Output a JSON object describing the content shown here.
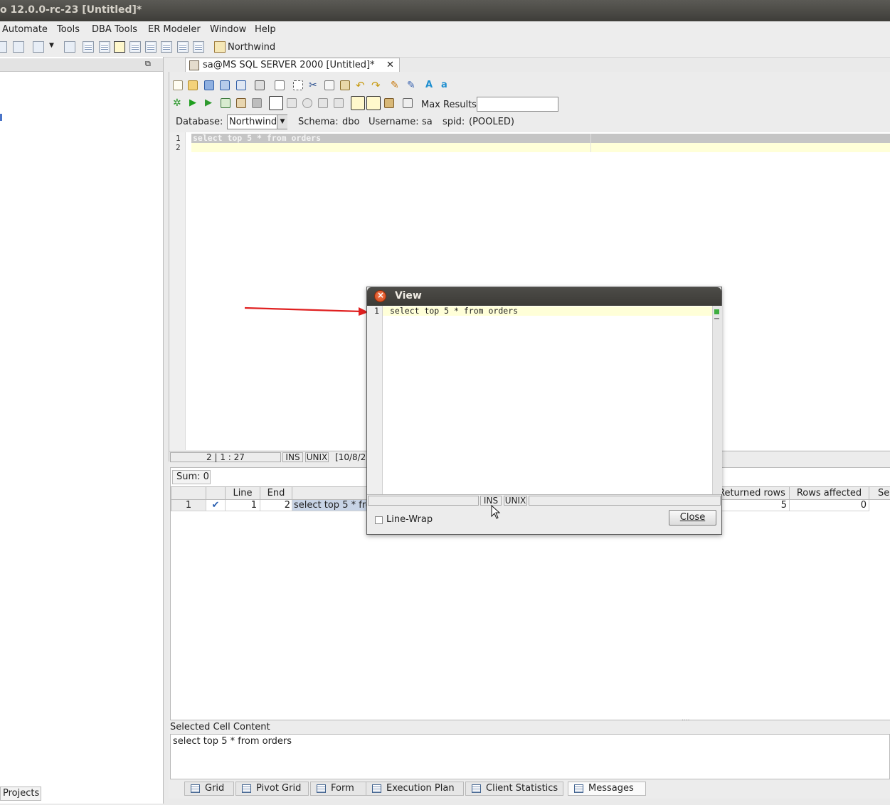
{
  "window": {
    "title": "o 12.0.0-rc-23 [Untitled]*"
  },
  "menu": [
    "Automate",
    "Tools",
    "DBA Tools",
    "ER Modeler",
    "Window",
    "Help"
  ],
  "toolbar": {
    "connection_label": "Northwind"
  },
  "left_panel": {
    "projects_tab": "Projects"
  },
  "document_tab": {
    "title": "sa@MS SQL SERVER 2000 [Untitled]*"
  },
  "sql_toolbar": {
    "max_results_label": "Max Results:",
    "max_results_value": ""
  },
  "connection_info": {
    "database_label": "Database:",
    "database_value": "Northwind",
    "schema_label": "Schema:",
    "schema_value": "dbo",
    "username_label": "Username:",
    "username_value": "sa",
    "spid_label": "spid:",
    "spid_value": "(POOLED)"
  },
  "editor": {
    "line_numbers": [
      "1",
      "2"
    ],
    "line1": "select top 5 * from orders"
  },
  "editor_status": {
    "position": "2 | 1 : 27",
    "mode": "INS",
    "line_endings": "UNIX",
    "timestamp": "[10/8/2"
  },
  "results": {
    "sum": "Sum: 0",
    "columns": {
      "line": "Line",
      "end": "End",
      "returned": "Returned rows",
      "affected": "Rows affected",
      "se": "Se"
    },
    "row": {
      "num": "1",
      "status": "✔",
      "line": "1",
      "end": "2",
      "sql": "select top 5 * fro",
      "returned": "5",
      "affected": "0"
    },
    "splitter": "....",
    "selected_label": "Selected Cell Content",
    "selected_value": "select top 5 * from orders"
  },
  "bottom_tabs": [
    "Grid",
    "Pivot Grid",
    "Form",
    "Execution Plan",
    "Client Statistics",
    "Messages"
  ],
  "dialog": {
    "title": "View",
    "line_number": "1",
    "content": "select top 5 * from orders",
    "status_mode": "INS",
    "status_line_endings": "UNIX",
    "line_wrap_label": "Line-Wrap",
    "close_button": "Close"
  },
  "colors": {
    "annotation_arrow": "#e02020",
    "current_line": "#ffffd8",
    "selection": "#c8d4e6"
  }
}
